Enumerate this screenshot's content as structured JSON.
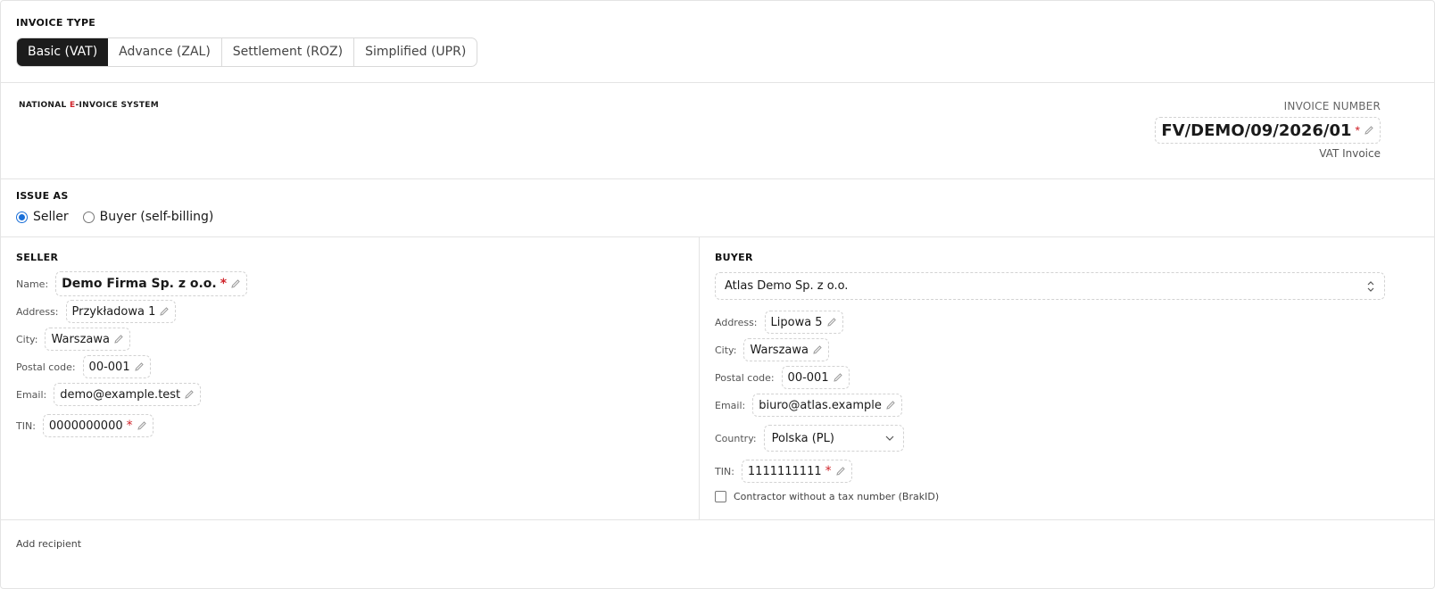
{
  "invoice_type": {
    "title": "INVOICE TYPE",
    "options": [
      "Basic (VAT)",
      "Advance (ZAL)",
      "Settlement (ROZ)",
      "Simplified (UPR)"
    ],
    "selected": "Basic (VAT)"
  },
  "header": {
    "system_prefix": "NATIONAL ",
    "system_accent": "E",
    "system_suffix": "-INVOICE SYSTEM",
    "invoice_number_label": "INVOICE NUMBER",
    "invoice_number": "FV/DEMO/09/2026/01",
    "required_mark": "*",
    "invoice_kind": "VAT Invoice"
  },
  "issue_as": {
    "title": "ISSUE AS",
    "options": [
      "Seller",
      "Buyer (self-billing)"
    ],
    "selected": "Seller"
  },
  "seller": {
    "title": "SELLER",
    "name_label": "Name:",
    "name": "Demo Firma Sp. z o.o.",
    "address_label": "Address:",
    "address": "Przykładowa 1",
    "city_label": "City:",
    "city": "Warszawa",
    "postal_label": "Postal code:",
    "postal": "00-001",
    "email_label": "Email:",
    "email": "demo@example.test",
    "tin_label": "TIN:",
    "tin": "0000000000"
  },
  "buyer": {
    "title": "BUYER",
    "selected_contractor": "Atlas Demo Sp. z o.o.",
    "address_label": "Address:",
    "address": "Lipowa 5",
    "city_label": "City:",
    "city": "Warszawa",
    "postal_label": "Postal code:",
    "postal": "00-001",
    "email_label": "Email:",
    "email": "biuro@atlas.example",
    "country_label": "Country:",
    "country": "Polska (PL)",
    "tin_label": "TIN:",
    "tin": "1111111111",
    "no_tax_checkbox_label": "Contractor without a tax number (BrakID)",
    "no_tax_checked": false
  },
  "recipient": {
    "add_label": "Add recipient"
  },
  "colors": {
    "accent_red": "#d0242b",
    "radio_blue": "#1a6fd8",
    "active_segment": "#1c1c1c"
  }
}
